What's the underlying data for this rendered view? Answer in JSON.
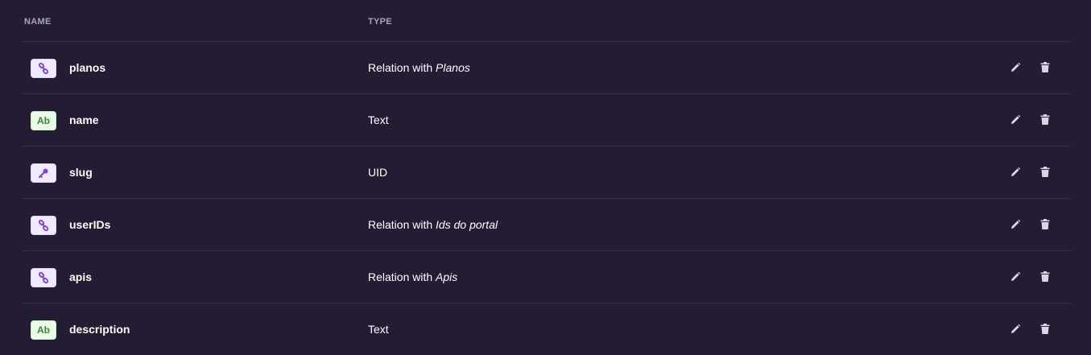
{
  "header": {
    "name_label": "NAME",
    "type_label": "TYPE"
  },
  "rows": [
    {
      "name": "planos",
      "icon": "relation-icon",
      "type_prefix": "Relation with ",
      "type_target": "Planos"
    },
    {
      "name": "name",
      "icon": "text-icon",
      "icon_text": "Ab",
      "type_prefix": "Text",
      "type_target": ""
    },
    {
      "name": "slug",
      "icon": "uid-key-icon",
      "type_prefix": "UID",
      "type_target": ""
    },
    {
      "name": "userIDs",
      "icon": "relation-icon",
      "type_prefix": "Relation with ",
      "type_target": "Ids do portal"
    },
    {
      "name": "apis",
      "icon": "relation-icon",
      "type_prefix": "Relation with ",
      "type_target": "Apis"
    },
    {
      "name": "description",
      "icon": "text-icon",
      "icon_text": "Ab",
      "type_prefix": "Text",
      "type_target": ""
    }
  ],
  "colors": {
    "background": "#231c33",
    "divider": "#352e48",
    "relation_accent": "#7b3ff2",
    "text_accent": "#2f8a3a",
    "action_icon": "#d8d6e4"
  }
}
